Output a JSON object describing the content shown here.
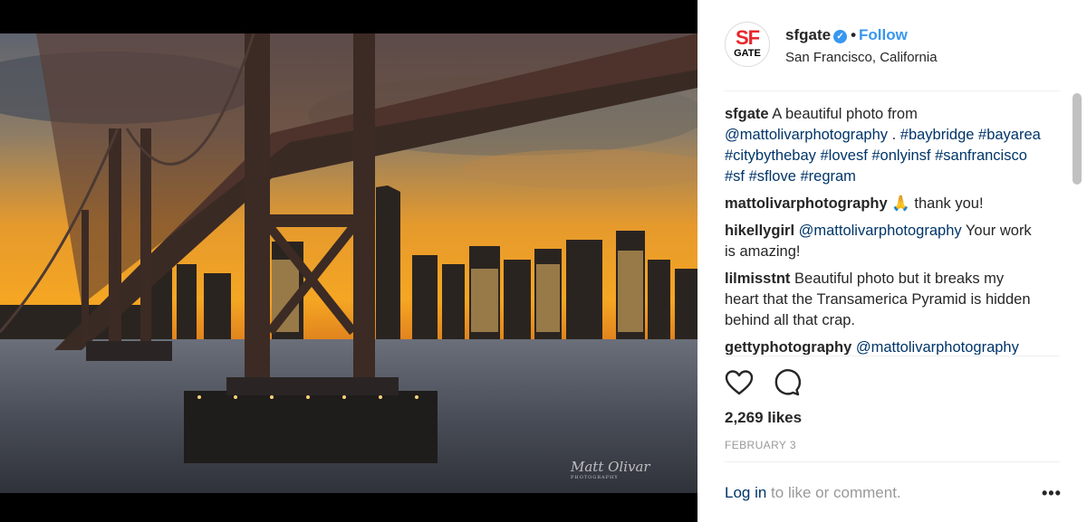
{
  "post": {
    "brand": {
      "line1": "SF",
      "line2": "GATE"
    },
    "username": "sfgate",
    "verified_glyph": "✓",
    "separator": "•",
    "follow_label": "Follow",
    "location": "San Francisco, California",
    "photo_signature": "Matt Olivar",
    "photo_signature_sub": "PHOTOGRAPHY"
  },
  "comments": [
    {
      "user": "sfgate",
      "segments": [
        {
          "text": "A beautiful photo from ",
          "type": "text"
        },
        {
          "text": "@mattolivarphotography",
          "type": "tag"
        },
        {
          "text": " . ",
          "type": "text"
        },
        {
          "text": "#baybridge",
          "type": "tag"
        },
        {
          "text": " ",
          "type": "text"
        },
        {
          "text": "#bayarea",
          "type": "tag"
        },
        {
          "text": " ",
          "type": "text"
        },
        {
          "text": "#citybythebay",
          "type": "tag"
        },
        {
          "text": " ",
          "type": "text"
        },
        {
          "text": "#lovesf",
          "type": "tag"
        },
        {
          "text": " ",
          "type": "text"
        },
        {
          "text": "#onlyinsf",
          "type": "tag"
        },
        {
          "text": " ",
          "type": "text"
        },
        {
          "text": "#sanfrancisco",
          "type": "tag"
        },
        {
          "text": " ",
          "type": "text"
        },
        {
          "text": "#sf",
          "type": "tag"
        },
        {
          "text": " ",
          "type": "text"
        },
        {
          "text": "#sflove",
          "type": "tag"
        },
        {
          "text": " ",
          "type": "text"
        },
        {
          "text": "#regram",
          "type": "tag"
        }
      ]
    },
    {
      "user": "mattolivarphotography",
      "segments": [
        {
          "text": " 🙏 thank you!",
          "type": "text"
        }
      ]
    },
    {
      "user": "hikellygirl",
      "segments": [
        {
          "text": "@mattolivarphotography",
          "type": "tag"
        },
        {
          "text": " Your work is amazing!",
          "type": "text"
        }
      ]
    },
    {
      "user": "lilmisstnt",
      "segments": [
        {
          "text": "Beautiful photo but it breaks my heart that the Transamerica Pyramid is hidden behind all that crap.",
          "type": "text"
        }
      ]
    },
    {
      "user": "gettyphotography",
      "segments": [
        {
          "text": "@mattolivarphotography",
          "type": "tag"
        }
      ]
    }
  ],
  "engagement": {
    "likes": "2,269 likes",
    "date": "FEBRUARY 3"
  },
  "footer": {
    "login_link": "Log in",
    "login_rest": " to like or comment.",
    "more_glyph": "•••"
  },
  "colors": {
    "link_blue": "#3897f0",
    "tag_navy": "#003569",
    "brand_red": "#e8262b",
    "muted_gray": "#999999"
  }
}
